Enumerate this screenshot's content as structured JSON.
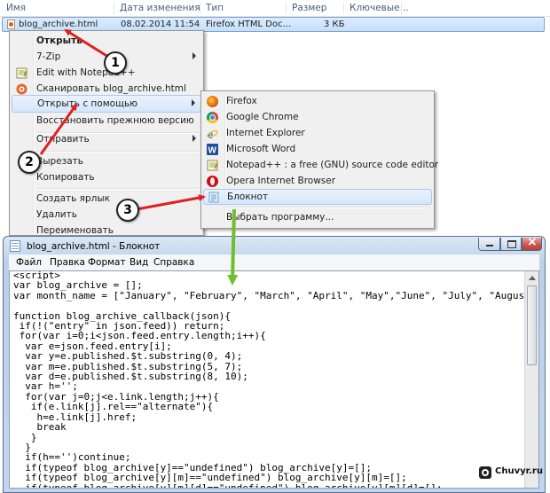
{
  "explorer": {
    "columns": [
      "Имя",
      "Дата изменения",
      "Тип",
      "Размер",
      "Ключевые..."
    ],
    "file": {
      "name": "blog_archive.html",
      "date": "08.02.2014 11:54",
      "type": "Firefox HTML Doc...",
      "size": "3 КБ"
    }
  },
  "context_menu": {
    "items": [
      {
        "label": "Открыть",
        "bold": true
      },
      {
        "label": "7-Zip",
        "submenu": true
      },
      {
        "label": "Edit with Notepad++",
        "icon": "notepadpp-icon"
      },
      {
        "label": "Сканировать blog_archive.html",
        "icon": "antivirus-icon"
      },
      {
        "label": "Открыть с помощью",
        "submenu": true,
        "highlighted": true
      },
      {
        "label": "Восстановить прежнюю версию"
      },
      {
        "label": "Отправить",
        "submenu": true
      },
      {
        "label": "Вырезать"
      },
      {
        "label": "Копировать"
      },
      {
        "label": "Создать ярлык"
      },
      {
        "label": "Удалить"
      },
      {
        "label": "Переименовать"
      }
    ]
  },
  "open_with_menu": {
    "items": [
      {
        "label": "Firefox",
        "icon": "firefox-icon",
        "color": "#e66000"
      },
      {
        "label": "Google Chrome",
        "icon": "chrome-icon",
        "color": "#db4437"
      },
      {
        "label": "Internet Explorer",
        "icon": "ie-icon",
        "color": "#1e90ff"
      },
      {
        "label": "Microsoft Word",
        "icon": "word-icon",
        "color": "#1f4e9c"
      },
      {
        "label": "Notepad++ : a free (GNU) source code editor",
        "icon": "notepadpp-icon",
        "color": "#7cb342"
      },
      {
        "label": "Opera Internet Browser",
        "icon": "opera-icon",
        "color": "#cc0f16"
      },
      {
        "label": "Блокнот",
        "icon": "notepad-icon",
        "color": "#6d9fd3",
        "highlighted": true
      },
      {
        "label": "Выбрать программу..."
      }
    ]
  },
  "notepad": {
    "title": "blog_archive.html - Блокнот",
    "menu": [
      "Файл",
      "Правка",
      "Формат",
      "Вид",
      "Справка"
    ],
    "code": "<script>\nvar blog_archive = [];\nvar month_name = [\"January\", \"February\", \"March\", \"April\", \"May\",\"June\", \"July\", \"August\"\n\nfunction blog_archive_callback(json){\n if(!(\"entry\" in json.feed)) return;\n for(var i=0;i<json.feed.entry.length;i++){\n  var e=json.feed.entry[i];\n  var y=e.published.$t.substring(0, 4);\n  var m=e.published.$t.substring(5, 7);\n  var d=e.published.$t.substring(8, 10);\n  var h='';\n  for(var j=0;j<e.link.length;j++){\n   if(e.link[j].rel==\"alternate\"){\n    h=e.link[j].href;\n    break\n   }\n  }\n  if(h=='')continue;\n  if(typeof blog_archive[y]==\"undefined\") blog_archive[y]=[];\n  if(typeof blog_archive[y][m]==\"undefined\") blog_archive[y][m]=[];\n  if(typeof blog_archive[y][m][d]==\"undefined\") blog_archive[y][m][d]=[];\n  blog_archive[y][m][d].push(\"<a href='\"+h+\"'>\"+e.title.$t+\"</a>\");"
  },
  "annotations": {
    "steps": [
      "1",
      "2",
      "3"
    ],
    "arrow_color": "#e02020",
    "green_arrow_color": "#6fbf2a"
  },
  "watermark": {
    "site": "Chuvyr.ru"
  }
}
